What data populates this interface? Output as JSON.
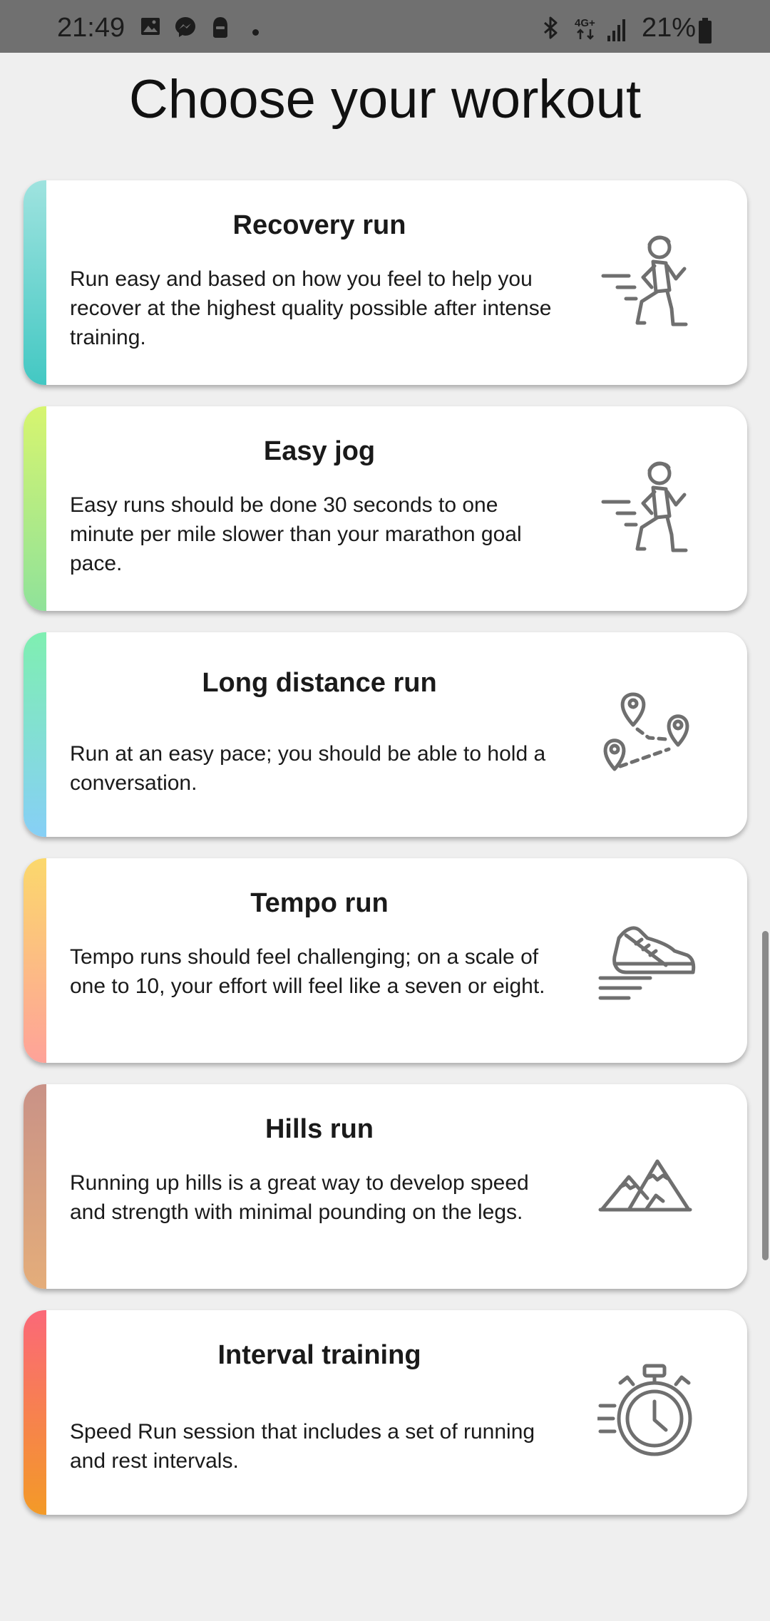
{
  "status_bar": {
    "time": "21:49",
    "network_label": "4G+",
    "battery": "21%",
    "icons": [
      "gallery-icon",
      "messenger-icon",
      "secure-folder-icon",
      "notification-dot",
      "bluetooth-icon",
      "network-icon",
      "signal-icon",
      "battery-icon"
    ]
  },
  "page": {
    "title": "Choose your workout"
  },
  "workouts": [
    {
      "title": "Recovery run",
      "description": "Run easy and based on how you feel to help you recover at the highest quality possible after intense training.",
      "icon": "runner-icon",
      "gradient": [
        "#9fe3df",
        "#43c8c3"
      ]
    },
    {
      "title": "Easy jog",
      "description": "Easy runs should be done 30 seconds to one minute per mile slower than your marathon goal pace.",
      "icon": "jogger-icon",
      "gradient": [
        "#d7f56f",
        "#8fe29a"
      ]
    },
    {
      "title": "Long distance run",
      "description": "Run at an easy pace; you should be able to hold a conversation.",
      "icon": "route-pins-icon",
      "gradient": [
        "#7fefb1",
        "#86cff6"
      ]
    },
    {
      "title": "Tempo run",
      "description": "Tempo runs should feel challenging; on a scale of one to 10, your effort will feel like a seven or eight.",
      "icon": "running-shoe-icon",
      "gradient": [
        "#fbd86c",
        "#fea299"
      ]
    },
    {
      "title": "Hills run",
      "description": "Running up hills is a great way to develop speed and strength with minimal pounding on the legs.",
      "icon": "mountains-icon",
      "gradient": [
        "#c99287",
        "#e4ad7a"
      ]
    },
    {
      "title": "Interval training",
      "description": "Speed Run session that includes a set of running and rest intervals.",
      "icon": "stopwatch-icon",
      "gradient": [
        "#fb6878",
        "#f39a27"
      ]
    }
  ]
}
